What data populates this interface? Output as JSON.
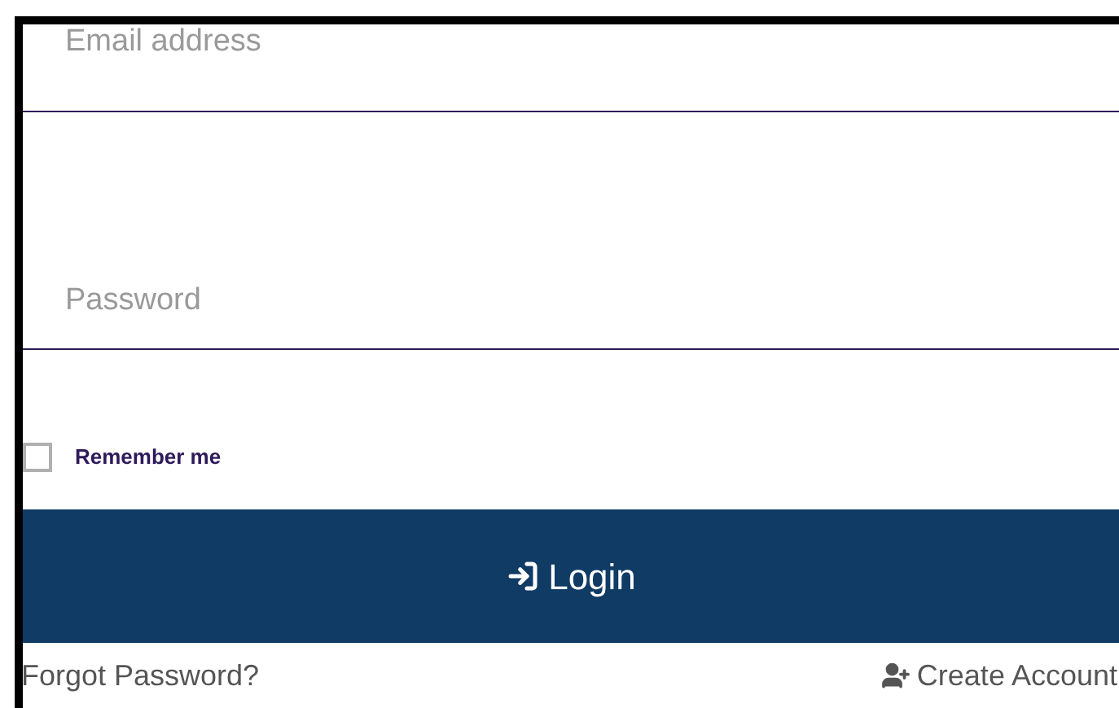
{
  "email": {
    "placeholder": "Email address"
  },
  "password": {
    "placeholder": "Password"
  },
  "remember": {
    "label": "Remember me",
    "checked": false
  },
  "login_button": {
    "label": "Login"
  },
  "links": [
    {
      "kind": "forgot",
      "label": "Forgot Password?"
    },
    {
      "kind": "create",
      "label": "Create Account"
    }
  ]
}
